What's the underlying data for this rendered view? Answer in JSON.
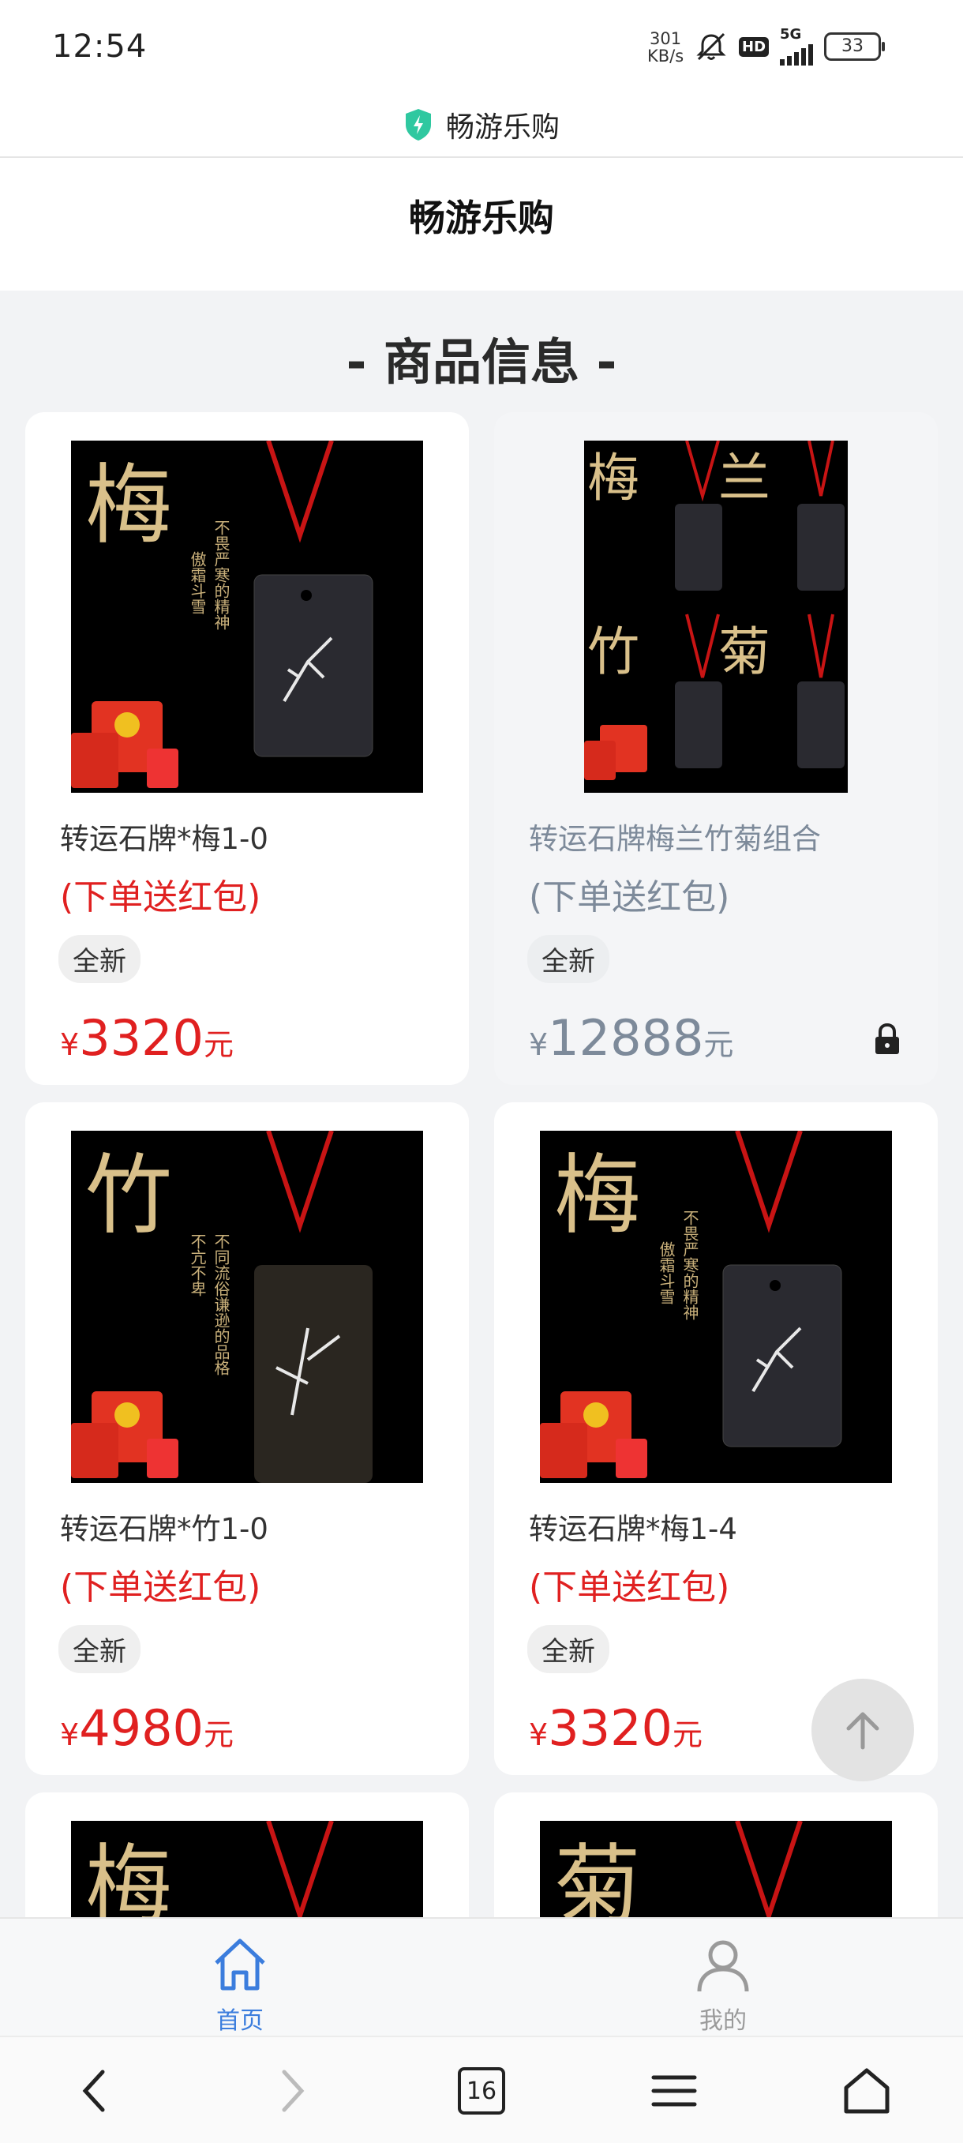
{
  "status": {
    "time": "12:54",
    "net_speed_value": "301",
    "net_speed_unit": "KB/s",
    "hd": "HD",
    "network": "5G",
    "battery": "33"
  },
  "browser": {
    "url_title": "畅游乐购"
  },
  "header": {
    "title": "畅游乐购"
  },
  "section": {
    "title": "- 商品信息 -"
  },
  "products": [
    {
      "name": "转运石牌*梅1-0",
      "promo": "(下单送红包)",
      "condition": "全新",
      "currency": "¥",
      "price": "3320",
      "unit": "元",
      "char": "梅",
      "locked": false
    },
    {
      "name": "转运石牌梅兰竹菊组合",
      "promo": "(下单送红包)",
      "condition": "全新",
      "currency": "¥",
      "price": "12888",
      "unit": "元",
      "chars": [
        "梅",
        "兰",
        "竹",
        "菊"
      ],
      "locked": true
    },
    {
      "name": "转运石牌*竹1-0",
      "promo": "(下单送红包)",
      "condition": "全新",
      "currency": "¥",
      "price": "4980",
      "unit": "元",
      "char": "竹",
      "locked": false
    },
    {
      "name": "转运石牌*梅1-4",
      "promo": "(下单送红包)",
      "condition": "全新",
      "currency": "¥",
      "price": "3320",
      "unit": "元",
      "char": "梅",
      "locked": false
    },
    {
      "char": "梅"
    },
    {
      "char": "菊"
    }
  ],
  "bottom_nav": {
    "home_label": "首页",
    "mine_label": "我的"
  },
  "system_bar": {
    "tabs_count": "16"
  },
  "colors": {
    "price_red": "#e02020",
    "disabled_text": "#7d8a9a",
    "nav_active": "#3b7ddd",
    "shield_green": "#2fc8a0"
  }
}
